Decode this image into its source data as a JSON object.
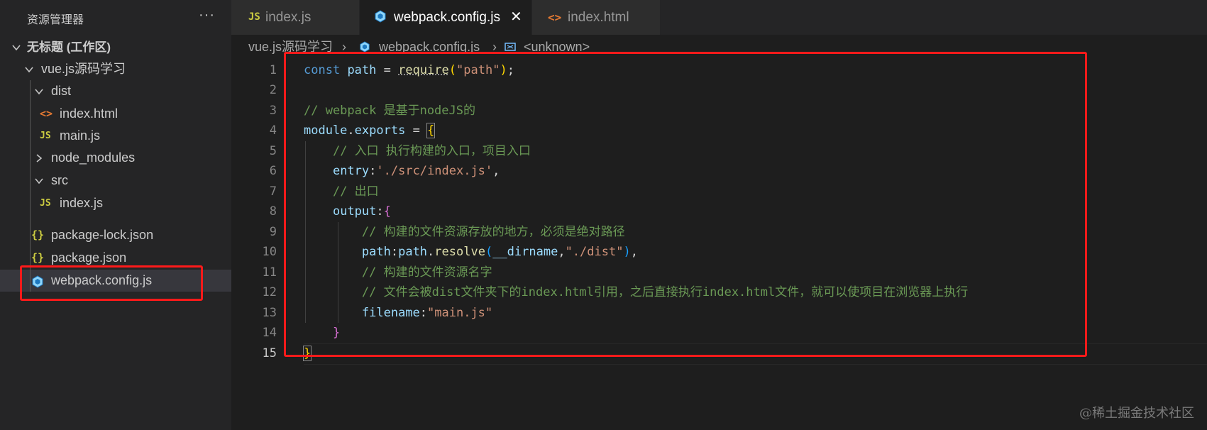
{
  "sidebar": {
    "title": "资源管理器",
    "more": "···",
    "workspace": "无标题 (工作区)",
    "items": [
      {
        "label": "vue.js源码学习",
        "kind": "folder-open"
      },
      {
        "label": "dist",
        "kind": "folder-open"
      },
      {
        "label": "index.html",
        "kind": "html",
        "icon": "<>"
      },
      {
        "label": "main.js",
        "kind": "js",
        "icon": "JS"
      },
      {
        "label": "node_modules",
        "kind": "folder-closed"
      },
      {
        "label": "src",
        "kind": "folder-open"
      },
      {
        "label": "index.js",
        "kind": "js",
        "icon": "JS"
      },
      {
        "label": "package-lock.json",
        "kind": "json",
        "icon": "{}"
      },
      {
        "label": "package.json",
        "kind": "json",
        "icon": "{}"
      },
      {
        "label": "webpack.config.js",
        "kind": "webpack",
        "selected": true
      }
    ]
  },
  "tabs": [
    {
      "label": "index.js",
      "icon": "JS",
      "active": false
    },
    {
      "label": "webpack.config.js",
      "icon": "webpack-cube",
      "active": true,
      "close": "✕"
    },
    {
      "label": "index.html",
      "icon": "<>",
      "active": false
    }
  ],
  "breadcrumb": {
    "folder": "vue.js源码学习",
    "sep": "›",
    "file": "webpack.config.js",
    "symbol": "<unknown>"
  },
  "editor": {
    "line_numbers": [
      "1",
      "2",
      "3",
      "4",
      "5",
      "6",
      "7",
      "8",
      "9",
      "10",
      "11",
      "12",
      "13",
      "14",
      "15"
    ],
    "active_line": "15"
  },
  "colors": {
    "annotation": "#ff1a1a",
    "keyword": "#569cd6",
    "variable": "#9cdcfe",
    "string": "#ce9178",
    "comment": "#6a9955",
    "function": "#dcdcaa"
  },
  "watermark": "@稀土掘金技术社区"
}
